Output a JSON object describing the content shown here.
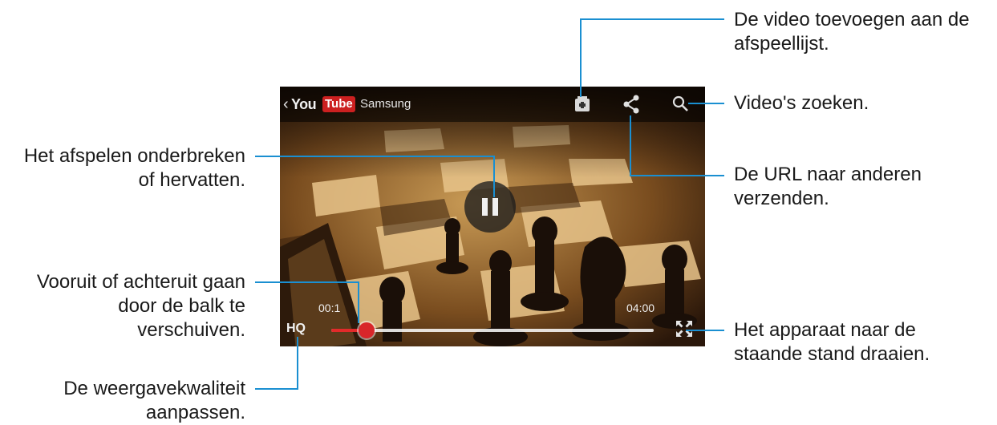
{
  "player": {
    "back_icon": "chevron-left-icon",
    "logo_you": "You",
    "logo_tube": "Tube",
    "channel": "Samsung",
    "icons": [
      "add-to-playlist-icon",
      "share-icon",
      "search-icon",
      "pause-icon",
      "rotate-screen-icon"
    ],
    "time_elapsed": "00:1",
    "time_total": "04:00",
    "quality_label": "HQ",
    "progress": 0.11,
    "colors": {
      "accent": "#1a8fd1",
      "progress": "#e22a2a",
      "logo_red": "#cc2020"
    }
  },
  "callouts": {
    "playlist": [
      "De video toevoegen aan de",
      "afspeellijst."
    ],
    "search": [
      "Video's zoeken."
    ],
    "share": [
      "De URL naar anderen",
      "verzenden."
    ],
    "pause": [
      "Het afspelen onderbreken",
      "of hervatten."
    ],
    "seek": [
      "Vooruit of achteruit gaan",
      "door de balk te",
      "verschuiven."
    ],
    "rotate": [
      "Het apparaat naar de",
      "staande stand draaien."
    ],
    "quality": [
      "De weergavekwaliteit",
      "aanpassen."
    ]
  }
}
